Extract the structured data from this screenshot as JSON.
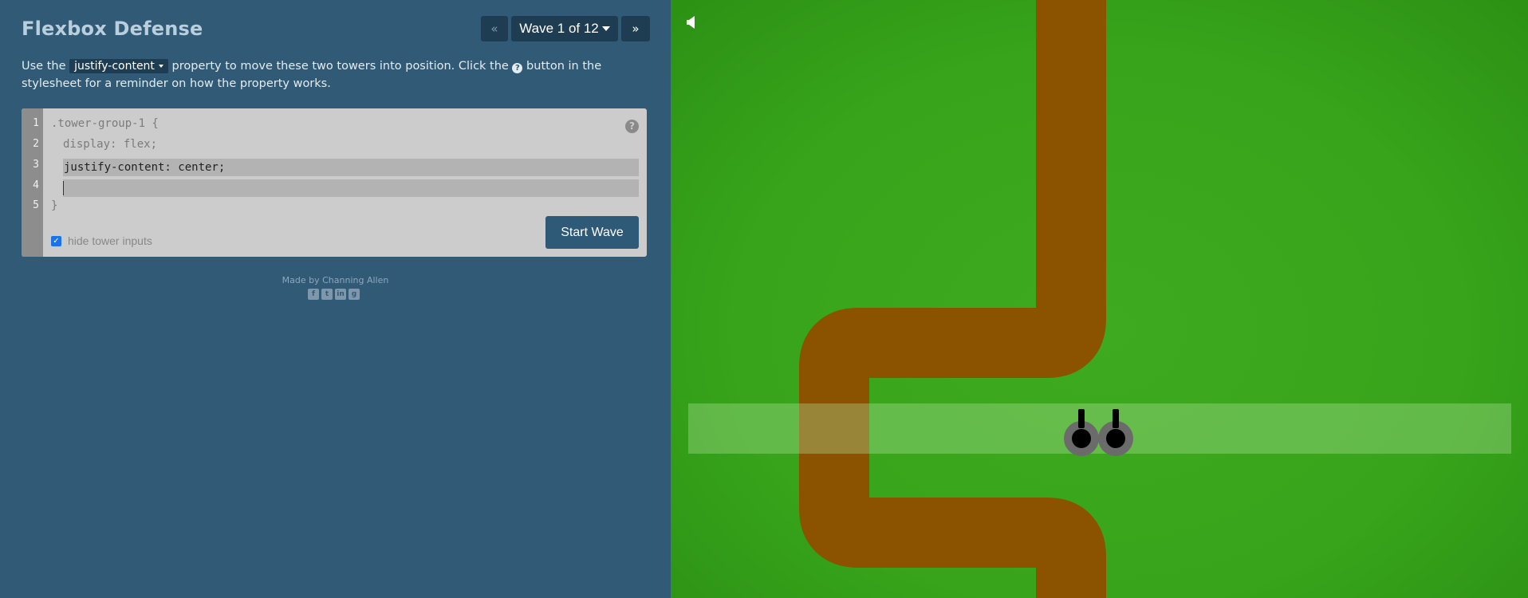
{
  "app": {
    "title": "Flexbox Defense"
  },
  "nav": {
    "prev_label": "«",
    "wave_label": "Wave 1 of 12",
    "next_label": "»"
  },
  "instructions": {
    "part1": "Use the ",
    "property": "justify-content",
    "part2": " property to move these two towers into position. Click the ",
    "part3": " button in the stylesheet for a reminder on how the property works.",
    "help_glyph": "?"
  },
  "editor": {
    "line_numbers": [
      "1",
      "2",
      "3",
      "4",
      "5"
    ],
    "selector_line": ".tower-group-1 {",
    "display_line": "display: flex;",
    "input_line_1": "justify-content: center;",
    "input_line_2": "",
    "closing_line": "}",
    "help_glyph": "?",
    "hide_inputs_label": "hide tower inputs",
    "hide_inputs_checked": true,
    "start_button_label": "Start Wave"
  },
  "footer": {
    "credit": "Made by Channing Allen",
    "socials": [
      "facebook-icon",
      "twitter-icon",
      "linkedin-icon",
      "github-icon"
    ]
  },
  "board": {
    "sound_icon": "speaker-icon",
    "colors": {
      "grass": "#37a41b",
      "path": "#8b5200",
      "tower_zone": "#b4e6a0",
      "tower_base": "#6b6b6b"
    },
    "tower_count": 2
  }
}
